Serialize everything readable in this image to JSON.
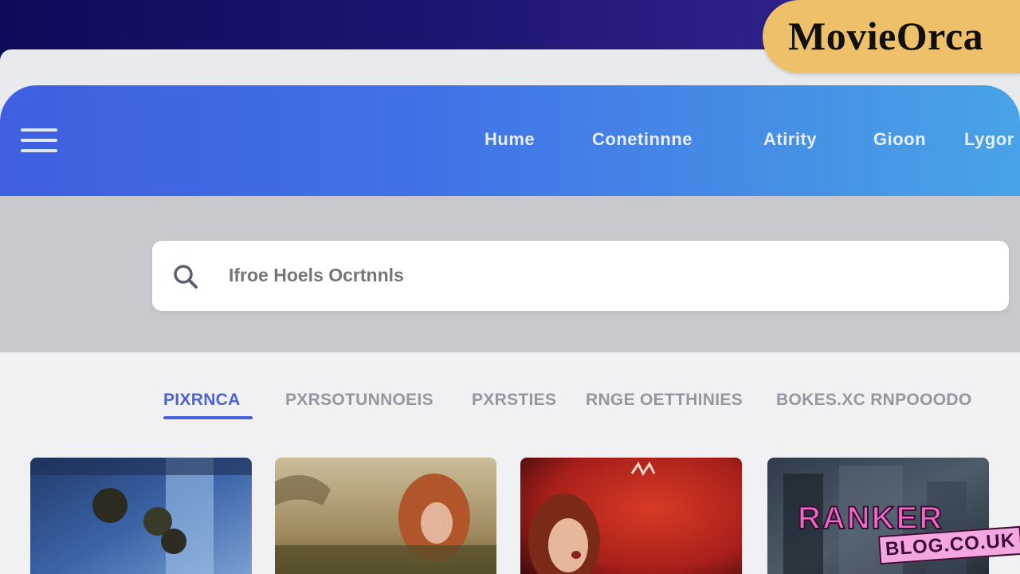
{
  "brand": {
    "name": "MovieOrca"
  },
  "navbar": {
    "menu_icon": "hamburger-menu-icon",
    "links": [
      "Hume",
      "Conetinnne",
      "Atirity",
      "Gioon",
      "Lygor"
    ]
  },
  "search": {
    "icon": "search-icon",
    "placeholder": "Ifroe Hoels Ocrtnnls"
  },
  "tabs": {
    "items": [
      "PIXRNCA",
      "PXRSOTUNNOEIS",
      "PXRSTIES",
      "RNGE OETTHINIES",
      "BOKES.XC RNPOOODO"
    ],
    "active_index": 0
  },
  "cards": [
    {
      "icon": "movie-poster-image-blue"
    },
    {
      "icon": "movie-poster-image-sepia"
    },
    {
      "icon": "movie-poster-image-red"
    },
    {
      "icon": "movie-poster-image-dark"
    }
  ],
  "watermark": {
    "top": "RANKER",
    "bottom": "BLOG.CO.UK"
  },
  "colors": {
    "nav_gradient_start": "#3f5fe0",
    "nav_gradient_end": "#49a3e6",
    "accent": "#4a63d8",
    "badge": "#eec06a"
  }
}
